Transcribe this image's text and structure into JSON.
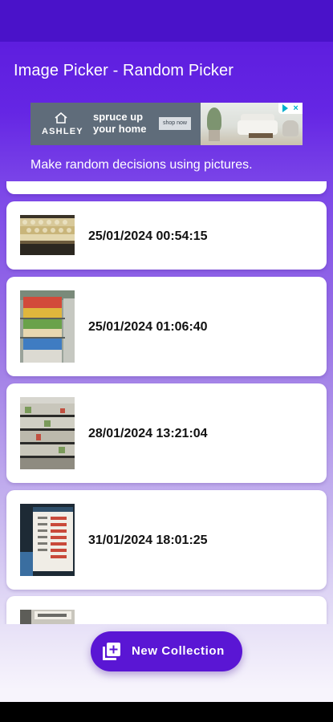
{
  "app_bar": {
    "title": "Image Picker - Random Picker"
  },
  "ad": {
    "brand": "ASHLEY",
    "headline": "spruce up your home",
    "cta": "shop now"
  },
  "subtitle": "Make random decisions using pictures.",
  "collections": [
    {
      "date": "25/01/2024 00:54:15",
      "thumb_icon": "photo-thumbnail"
    },
    {
      "date": "25/01/2024 01:06:40",
      "thumb_icon": "photo-thumbnail"
    },
    {
      "date": "28/01/2024 13:21:04",
      "thumb_icon": "photo-thumbnail"
    },
    {
      "date": "31/01/2024 18:01:25",
      "thumb_icon": "photo-thumbnail"
    }
  ],
  "fab": {
    "label": "New Collection",
    "icon": "add-collection-icon"
  },
  "colors": {
    "primary": "#5a16d4",
    "status_bar": "#4a12c9",
    "card": "#ffffff",
    "ad_background": "#5f6c7a",
    "adchoices": "#00aecd"
  }
}
